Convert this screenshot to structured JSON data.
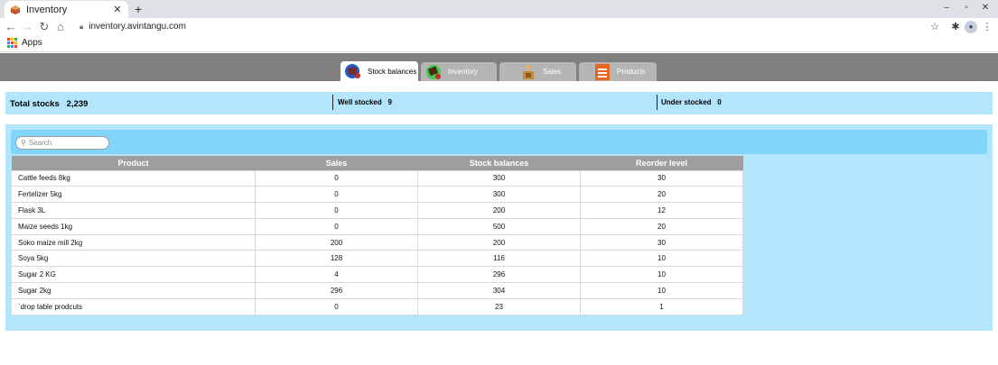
{
  "browser": {
    "tab_title": "Inventory",
    "url": "inventory.avintangu.com",
    "bookmarks_apps": "Apps"
  },
  "nav": {
    "tabs": [
      {
        "label": "Stock balances",
        "active": true
      },
      {
        "label": "Inventory",
        "active": false
      },
      {
        "label": "Sales",
        "active": false
      },
      {
        "label": "Products",
        "active": false
      }
    ]
  },
  "summary": {
    "total_label": "Total stocks",
    "total_value": "2,239",
    "well_label": "Well stocked",
    "well_value": "9",
    "under_label": "Under stocked",
    "under_value": "0"
  },
  "search": {
    "placeholder": "Search"
  },
  "table": {
    "headers": [
      "Product",
      "Sales",
      "Stock balances",
      "Reorder level"
    ],
    "rows": [
      [
        "Cattle feeds 8kg",
        "0",
        "300",
        "30"
      ],
      [
        "Fertelizer 5kg",
        "0",
        "300",
        "20"
      ],
      [
        "Flask 3L",
        "0",
        "200",
        "12"
      ],
      [
        "Maize seeds 1kg",
        "0",
        "500",
        "20"
      ],
      [
        "Soko maize mill 2kg",
        "200",
        "200",
        "30"
      ],
      [
        "Soya 5kg",
        "128",
        "116",
        "10"
      ],
      [
        "Sugar 2 KG",
        "4",
        "296",
        "10"
      ],
      [
        "Sugar 2kg",
        "296",
        "304",
        "10"
      ],
      [
        "`drop table prodcuts",
        "0",
        "23",
        "1"
      ]
    ]
  },
  "colors": {
    "nav_bg": "#808080",
    "panel_bg": "#b3e5fc",
    "toolbar_bg": "#81d4fa",
    "header_bg": "#9e9e9e"
  }
}
